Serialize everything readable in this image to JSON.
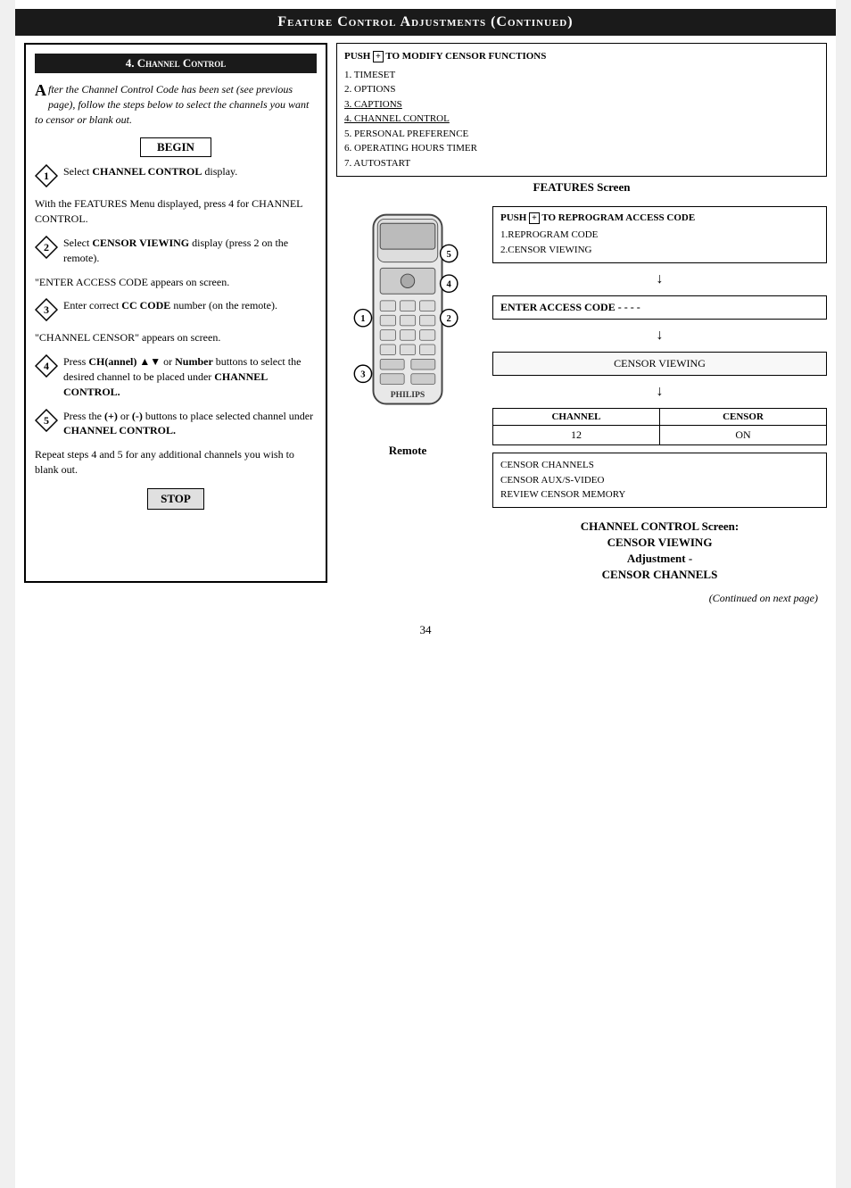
{
  "page": {
    "title": "Feature Control Adjustments (Continued)",
    "page_number": "34"
  },
  "section": {
    "header": "4. Channel Control",
    "intro": {
      "initial": "A",
      "text": "fter the Channel Control Code has been set (see previous page), follow the steps below to select the channels you want to censor or blank out."
    },
    "begin_label": "BEGIN",
    "steps": [
      {
        "number": "1",
        "text": "Select CHANNEL CONTROL display."
      },
      {
        "number": "2",
        "text": "Select CENSOR VIEWING display (press 2 on the remote)."
      },
      {
        "note": "\"ENTER ACCESS CODE appears on screen."
      },
      {
        "number": "3",
        "text": "Enter correct CC CODE number (on the remote)."
      },
      {
        "note": "\"CHANNEL CENSOR\" appears on screen."
      },
      {
        "number": "4",
        "text": "Press CH(annel) ▲▼ or Number buttons to select the desired channel to be placed under CHANNEL CONTROL."
      },
      {
        "number": "5",
        "text": "Press the (+) or (-) buttons to place selected channel under CHANNEL CONTROL."
      }
    ],
    "repeat_text": "Repeat steps 4 and 5 for any additional channels you wish to blank out.",
    "stop_label": "STOP"
  },
  "features_screen": {
    "push_line": "PUSH",
    "push_symbol": "+",
    "push_rest": " TO MODIFY CENSOR FUNCTIONS",
    "menu_items": [
      {
        "number": "1",
        "text": "TIMESET"
      },
      {
        "number": "2",
        "text": "OPTIONS"
      },
      {
        "number": "3",
        "text": "CAPTIONS",
        "underline": true
      },
      {
        "number": "4",
        "text": "CHANNEL CONTROL",
        "underline": true
      },
      {
        "number": "5",
        "text": "PERSONAL PREFERENCE"
      },
      {
        "number": "6",
        "text": "OPERATING HOURS TIMER"
      },
      {
        "number": "7",
        "text": "AUTOSTART"
      }
    ],
    "label": "FEATURES Screen"
  },
  "reprogram_screen": {
    "push_line": "PUSH",
    "push_symbol": "+",
    "push_rest": " TO REPROGRAM ACCESS CODE",
    "items": [
      "1.REPROGRAM CODE",
      "2.CENSOR VIEWING"
    ]
  },
  "access_code_screen": {
    "text": "ENTER ACCESS CODE - - - -"
  },
  "censor_viewing_screen": {
    "text": "CENSOR VIEWING"
  },
  "channel_censor_screen": {
    "headers": [
      "CHANNEL",
      "CENSOR"
    ],
    "values": [
      "12",
      "ON"
    ]
  },
  "bottom_screen": {
    "items": [
      "CENSOR CHANNELS",
      "CENSOR AUX/S-VIDEO",
      "REVIEW CENSOR MEMORY"
    ]
  },
  "channel_control_label": {
    "line1": "CHANNEL CONTROL Screen:",
    "line2": "CENSOR VIEWING",
    "line3": "Adjustment -",
    "line4": "CENSOR CHANNELS"
  },
  "remote_label": "Remote",
  "remote_brand": "PHILIPS",
  "step_labels_on_remote": [
    "1",
    "2",
    "3",
    "4",
    "5"
  ],
  "continued_text": "(Continued on next page)"
}
